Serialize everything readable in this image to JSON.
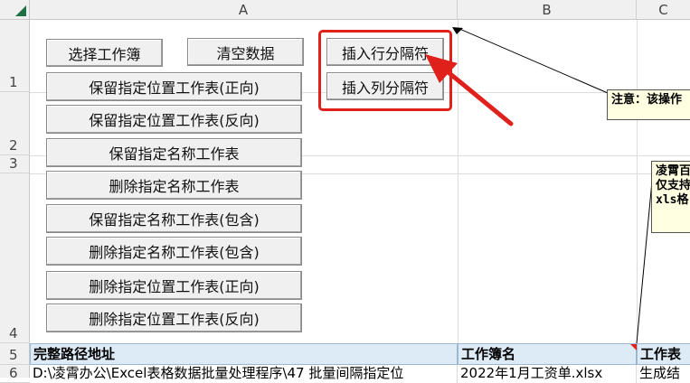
{
  "columns": {
    "a": "A",
    "b": "B",
    "c": "C"
  },
  "rows": {
    "r1": "1",
    "r2": "2",
    "r3": "3",
    "r4": "4",
    "r5": "5",
    "r6": "6"
  },
  "buttons": {
    "select_workbook": "选择工作簿",
    "clear_data": "清空数据",
    "insert_row_separator": "插入行分隔符",
    "insert_col_separator": "插入列分隔符",
    "keep_pos_forward": "保留指定位置工作表(正向)",
    "keep_pos_reverse": "保留指定位置工作表(反向)",
    "keep_name": "保留指定名称工作表",
    "delete_name": "删除指定名称工作表",
    "keep_name_contains": "保留指定名称工作表(包含)",
    "delete_name_contains": "删除指定名称工作表(包含)",
    "delete_pos_forward": "删除指定位置工作表(正向)",
    "delete_pos_reverse": "删除指定位置工作表(反向)"
  },
  "comments": {
    "note1": "注意：该操作",
    "note2": "凌霄百\n仅支持\nxls格"
  },
  "table": {
    "headers": [
      "完整路径地址",
      "工作簿名",
      "工作表"
    ],
    "row1": [
      "D:\\凌霄办公\\Excel表格数据批量处理程序\\47 批量间隔指定位",
      "2022年1月工资单.xlsx",
      "生成结"
    ]
  },
  "colors": {
    "accent_red": "#e0201b",
    "header_fill": "#ddebf7",
    "comment_fill": "#ffffe1",
    "excel_green": "#1e7145"
  }
}
